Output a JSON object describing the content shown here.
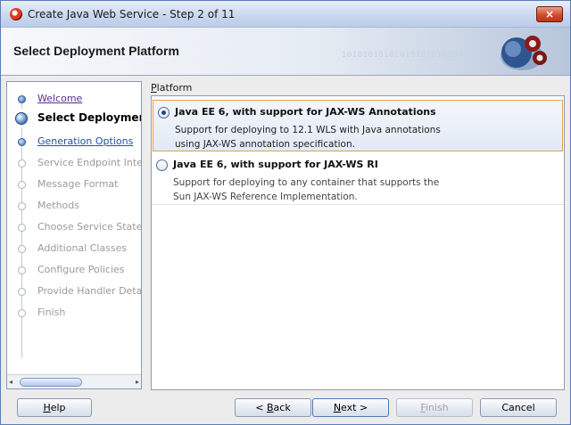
{
  "window": {
    "title": "Create Java Web Service - Step 2 of 11",
    "close_label": "×"
  },
  "header": {
    "title": "Select Deployment Platform",
    "binary_text": "10101010101010101010101"
  },
  "nav": {
    "items": [
      {
        "label": "Welcome",
        "state": "done"
      },
      {
        "label": "Select Deployment Pl",
        "state": "current"
      },
      {
        "label": "Generation Options",
        "state": "link"
      },
      {
        "label": "Service Endpoint Interfa",
        "state": "disabled"
      },
      {
        "label": "Message Format",
        "state": "disabled"
      },
      {
        "label": "Methods",
        "state": "disabled"
      },
      {
        "label": "Choose Service State",
        "state": "disabled"
      },
      {
        "label": "Additional Classes",
        "state": "disabled"
      },
      {
        "label": "Configure Policies",
        "state": "disabled"
      },
      {
        "label": "Provide Handler Details",
        "state": "disabled"
      },
      {
        "label": "Finish",
        "state": "disabled"
      }
    ],
    "scroll_left": "◂",
    "scroll_right": "▸"
  },
  "content": {
    "section_label_mnemonic": "P",
    "section_label_rest": "latform",
    "options": [
      {
        "title": "Java EE 6, with support for JAX-WS Annotations",
        "desc_line1": "Support for deploying to 12.1 WLS with Java annotations",
        "desc_line2": "using JAX-WS annotation specification.",
        "selected": true
      },
      {
        "title": "Java EE 6, with support for JAX-WS RI",
        "desc_line1": "Support for deploying to any container that supports the",
        "desc_line2": "Sun JAX-WS Reference Implementation.",
        "selected": false
      }
    ]
  },
  "buttons": {
    "help_mn": "H",
    "help_rest": "elp",
    "back_pre": "< ",
    "back_mn": "B",
    "back_rest": "ack",
    "next_mn": "N",
    "next_rest": "ext >",
    "finish_mn": "F",
    "finish_rest": "inish",
    "cancel": "Cancel"
  },
  "colors": {
    "accent": "#2c5aa0",
    "selection_border": "#e1a34a",
    "close_button": "#cf4c2b"
  }
}
